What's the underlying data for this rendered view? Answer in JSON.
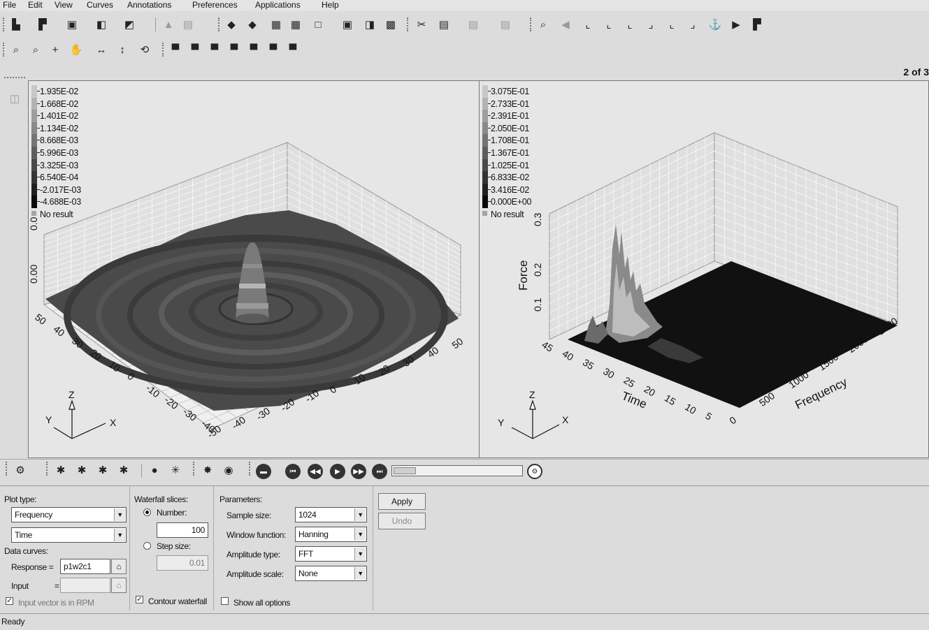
{
  "menu": [
    "File",
    "Edit",
    "View",
    "Curves",
    "Annotations",
    "Preferences",
    "Applications",
    "Help"
  ],
  "page_indicator": "2 of 3",
  "left_plot": {
    "legend": [
      "1.935E-02",
      "1.668E-02",
      "1.401E-02",
      "1.134E-02",
      "8.668E-03",
      "5.996E-03",
      "3.325E-03",
      "6.540E-04",
      "-2.017E-03",
      "-4.688E-03"
    ],
    "no_result": "No result",
    "axis_a_ticks": [
      "50",
      "40",
      "30",
      "20",
      "10",
      "0",
      "-10",
      "-20",
      "-30",
      "-40"
    ],
    "axis_b_ticks": [
      "-50",
      "-40",
      "-30",
      "-20",
      "-10",
      "0",
      "10",
      "20",
      "30",
      "40",
      "50"
    ],
    "partial_z_labels": [
      "0.0",
      "0.00"
    ],
    "triad": {
      "z": "Z",
      "y": "Y",
      "x": "X"
    }
  },
  "right_plot": {
    "legend": [
      "3.075E-01",
      "2.733E-01",
      "2.391E-01",
      "2.050E-01",
      "1.708E-01",
      "1.367E-01",
      "1.025E-01",
      "6.833E-02",
      "3.416E-02",
      "0.000E+00"
    ],
    "no_result": "No result",
    "z_label": "Force",
    "z_ticks": [
      "0.1",
      "0.2",
      "0.3"
    ],
    "time_label": "Time",
    "time_ticks": [
      "45",
      "40",
      "35",
      "30",
      "25",
      "20",
      "15",
      "10",
      "5"
    ],
    "freq_label": "Frequency",
    "freq_ticks": [
      "0",
      "500",
      "1000",
      "1500",
      "2000",
      "2500"
    ],
    "triad": {
      "z": "Z",
      "y": "Y",
      "x": "X"
    }
  },
  "options": {
    "plot_type_label": "Plot type:",
    "plot_type_value": "Frequency",
    "second_axis_value": "Time",
    "data_curves_label": "Data curves:",
    "response_label": "Response =",
    "response_value": "p1w2c1",
    "input_label": "Input",
    "input_equals": "=",
    "input_value": "",
    "rpm_label": "Input vector is in RPM",
    "waterfall_label": "Waterfall slices:",
    "number_label": "Number:",
    "number_value": "100",
    "step_label": "Step size:",
    "step_value": "0.01",
    "contour_label": "Contour waterfall",
    "parameters_label": "Parameters:",
    "sample_size_label": "Sample size:",
    "sample_size_value": "1024",
    "window_label": "Window function:",
    "window_value": "Hanning",
    "amp_type_label": "Amplitude type:",
    "amp_type_value": "FFT",
    "amp_scale_label": "Amplitude scale:",
    "amp_scale_value": "None",
    "show_all_label": "Show all options",
    "apply_label": "Apply",
    "undo_label": "Undo"
  },
  "status": "Ready"
}
